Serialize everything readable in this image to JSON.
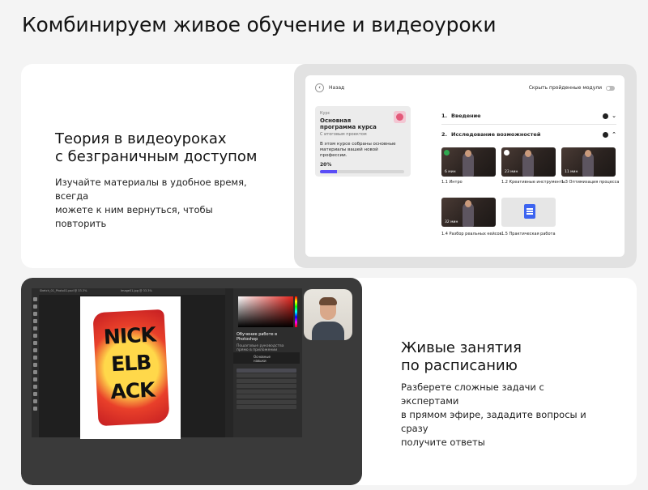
{
  "page": {
    "title": "Комбинируем живое обучение и видеоуроки"
  },
  "card_video": {
    "title_line1": "Теория в видеоуроках",
    "title_line2": "с безграничным доступом",
    "desc_line1": "Изучайте материалы в удобное время, всегда",
    "desc_line2": "можете к ним вернуться, чтобы повторить",
    "mockup": {
      "back_label": "Назад",
      "hide_label": "Скрыть пройденные модули",
      "course": {
        "label": "Курс",
        "name": "Основная программа курса",
        "tag": "С итоговым проектом",
        "description": "В этом курсе собраны основные материалы вашей новой профессии.",
        "progress_text": "20%",
        "progress": 0.2
      },
      "sections": [
        {
          "num": "1.",
          "title": "Введение",
          "done": true
        },
        {
          "num": "2.",
          "title": "Исследование возможностей",
          "done": true
        }
      ],
      "lessons": [
        {
          "caption": "1.1 Интро",
          "duration": "6 мин",
          "done": true
        },
        {
          "caption": "1.2 Креативные инструменты",
          "duration": "23 мин",
          "done": true
        },
        {
          "caption": "1.3 Оптимизация процесса",
          "duration": "11 мин",
          "done": false
        },
        {
          "caption": "1.4 Разбор реальных кейсов",
          "duration": "32 мин",
          "done": false
        },
        {
          "caption": "1.5 Практическая работа",
          "duration": "",
          "done": false
        }
      ]
    }
  },
  "card_live": {
    "title_line1": "Живые занятия",
    "title_line2": "по расписанию",
    "desc_line1": "Разберете сложные задачи с экспертами",
    "desc_line2": "в прямом эфире, зададите вопросы и сразу",
    "desc_line3": "получите ответы",
    "photoshop": {
      "tab1": "Sketch_01_Photo01.psd @ 33.3%",
      "tab2": "Image01.jpg @ 33.3%",
      "learn_title": "Обучение работе в Photoshop",
      "learn_sub": "Пошаговые руководства прямо в приложении",
      "panel_label": "Основные навыки",
      "canvas_text": "NICK ELB ACK"
    }
  }
}
